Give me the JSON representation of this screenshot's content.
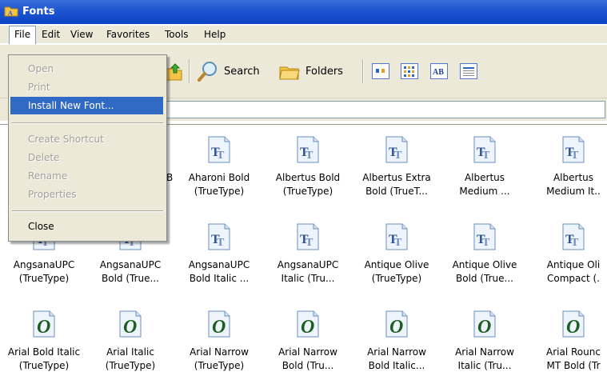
{
  "window": {
    "title": "Fonts"
  },
  "menubar": [
    "File",
    "Edit",
    "View",
    "Favorites",
    "Tools",
    "Help"
  ],
  "toolbar": {
    "search_label": "Search",
    "folders_label": "Folders"
  },
  "file_menu": {
    "items": [
      {
        "label": "Open",
        "state": "disabled"
      },
      {
        "label": "Print",
        "state": "disabled"
      },
      {
        "label": "Install New Font...",
        "state": "highlighted"
      },
      {
        "label": "Create Shortcut",
        "state": "disabled"
      },
      {
        "label": "Delete",
        "state": "disabled"
      },
      {
        "label": "Rename",
        "state": "disabled"
      },
      {
        "label": "Properties",
        "state": "disabled"
      },
      {
        "label": "Close",
        "state": "enabled"
      }
    ]
  },
  "partial_label_fragment": "B",
  "fonts": [
    [
      {
        "line1": "",
        "line2": "",
        "type": "truetype"
      },
      {
        "line1": "",
        "line2": "",
        "type": "truetype"
      },
      {
        "line1": "Aharoni Bold",
        "line2": "(TrueType)",
        "type": "truetype"
      },
      {
        "line1": "Albertus Bold",
        "line2": "(TrueType)",
        "type": "truetype"
      },
      {
        "line1": "Albertus Extra",
        "line2": "Bold (TrueT...",
        "type": "truetype"
      },
      {
        "line1": "Albertus",
        "line2": "Medium ...",
        "type": "truetype"
      },
      {
        "line1": "Albertus",
        "line2": "Medium It..",
        "type": "truetype"
      }
    ],
    [
      {
        "line1": "AngsanaUPC",
        "line2": "(TrueType)",
        "type": "truetype"
      },
      {
        "line1": "AngsanaUPC",
        "line2": "Bold (True...",
        "type": "truetype"
      },
      {
        "line1": "AngsanaUPC",
        "line2": "Bold Italic ...",
        "type": "truetype"
      },
      {
        "line1": "AngsanaUPC",
        "line2": "Italic (Tru...",
        "type": "truetype"
      },
      {
        "line1": "Antique Olive",
        "line2": "(TrueType)",
        "type": "truetype"
      },
      {
        "line1": "Antique Olive",
        "line2": "Bold (True...",
        "type": "truetype"
      },
      {
        "line1": "Antique Oli",
        "line2": "Compact (.",
        "type": "truetype"
      }
    ],
    [
      {
        "line1": "Arial Bold Italic",
        "line2": "(TrueType)",
        "type": "opentype"
      },
      {
        "line1": "Arial Italic",
        "line2": "(TrueType)",
        "type": "opentype"
      },
      {
        "line1": "Arial Narrow",
        "line2": "(TrueType)",
        "type": "opentype"
      },
      {
        "line1": "Arial Narrow",
        "line2": "Bold (Tru...",
        "type": "opentype"
      },
      {
        "line1": "Arial Narrow",
        "line2": "Bold Italic...",
        "type": "opentype"
      },
      {
        "line1": "Arial Narrow",
        "line2": "Italic (Tru...",
        "type": "opentype"
      },
      {
        "line1": "Arial Rounc",
        "line2": "MT Bold (Tr",
        "type": "opentype"
      }
    ]
  ],
  "colors": {
    "titlebar": "#0d43c6",
    "menu_highlight": "#316ac5",
    "chrome": "#ece9d8"
  }
}
